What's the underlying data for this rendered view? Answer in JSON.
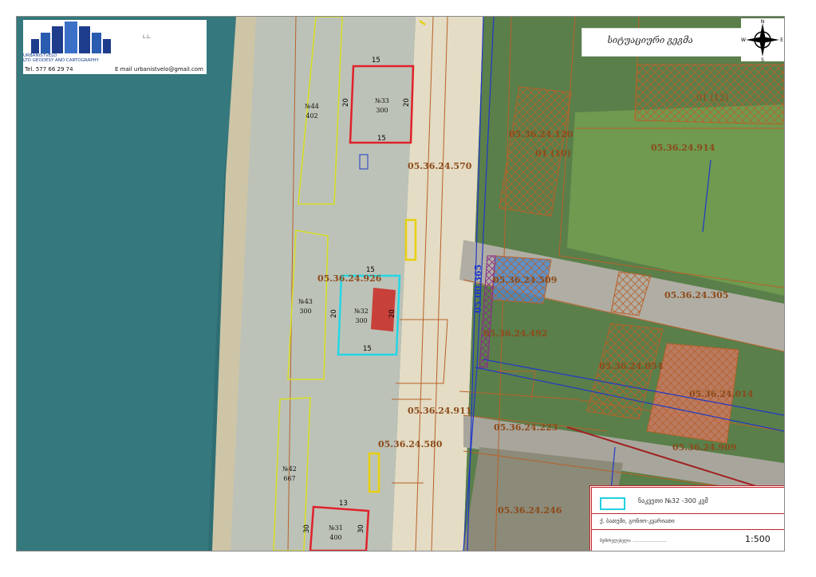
{
  "header": {
    "tel_label": "Tel.",
    "tel_value": "577 66 29 74",
    "email_label": "E mail",
    "email_value": "urbanistvelo@gmail.com",
    "company_line1": "URBANISTVELO",
    "company_line2": "LTD GEODESY AND CARTOGRAPHY",
    "logo_mark": "L.L.",
    "title": "სიტუაციური გეგმა"
  },
  "compass": {
    "n": "N",
    "s": "S",
    "e": "E",
    "w": "W"
  },
  "cadastral_labels": [
    "05.36.24.570",
    "05.36.24.120",
    "05.36.24.914",
    "05.36.24.509",
    "05.36.24.305",
    "05.36.24.926",
    "05.36.24.492",
    "05.36.24.054",
    "05.36.24.014",
    "05.36.24.911",
    "05.36.24.223",
    "05.36.24.909",
    "05.36.24.580",
    "05.36.24.246"
  ],
  "road_label": "05.00.365",
  "building_labels": [
    "01 (10)",
    "01 (12)"
  ],
  "parcels": [
    {
      "number": "№44",
      "area": "402"
    },
    {
      "number": "№33",
      "area": "300",
      "w": "15",
      "h": "20"
    },
    {
      "number": "№43",
      "area": "300"
    },
    {
      "number": "№32",
      "area": "300",
      "w": "15",
      "h": "20"
    },
    {
      "number": "№42",
      "area": "667"
    },
    {
      "number": "№31",
      "area": "400",
      "w": "13",
      "h": "30"
    }
  ],
  "legend": {
    "parcel_text": "ნაკვეთი №32 -300 კვმ",
    "project_text": "ქ. ბათუმი, გონიო-კვარიათი",
    "author_text": "შემსრულებელი: ...........................",
    "scale": "1:500"
  },
  "colors": {
    "sea": "#2f6e73",
    "beach": "#bcc2b8",
    "cadastre": "#b8612a",
    "parcel_red": "#e0212a",
    "parcel_cyan": "#22d6e6",
    "yellow": "#d8e020",
    "road_blue": "#2038c8"
  }
}
